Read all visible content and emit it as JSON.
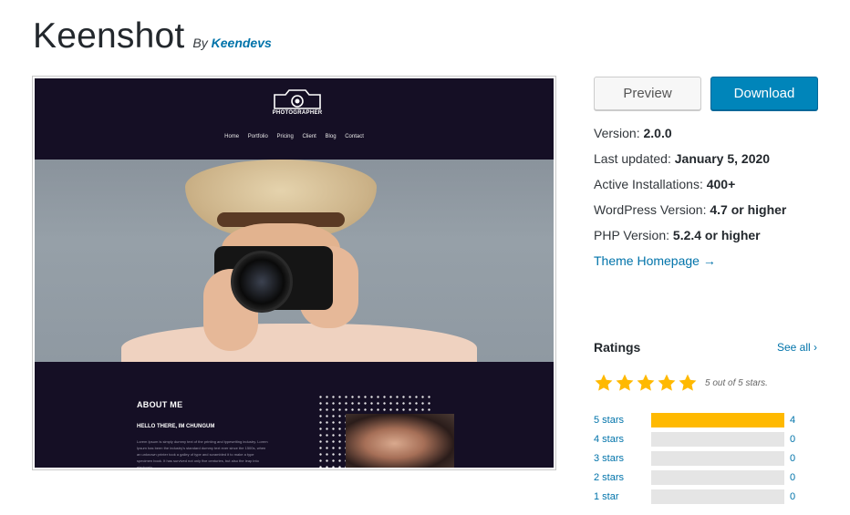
{
  "theme": {
    "title": "Keenshot",
    "by_label": "By",
    "author": "Keendevs"
  },
  "screenshot": {
    "logo_text": "PHOTOGRAPHER",
    "nav": [
      "Home",
      "Portfolio",
      "Pricing",
      "Client",
      "Blog",
      "Contact"
    ],
    "about_title": "ABOUT ME",
    "about_subtitle": "HELLO THERE, IM CHUNGUM",
    "about_text": "Lorem Ipsum is simply dummy text of the printing and typesetting industry. Lorem Ipsum has been the industry's standard dummy text ever since the 1500s, when an unknown printer took a galley of type and scrambled it to make a type specimen book. It has survived not only five centuries, but also the leap into electronic"
  },
  "actions": {
    "preview_label": "Preview",
    "download_label": "Download"
  },
  "meta": {
    "version_label": "Version:",
    "version_value": "2.0.0",
    "updated_label": "Last updated:",
    "updated_value": "January 5, 2020",
    "installs_label": "Active Installations:",
    "installs_value": "400+",
    "wp_label": "WordPress Version:",
    "wp_value": "4.7 or higher",
    "php_label": "PHP Version:",
    "php_value": "5.2.4 or higher",
    "homepage_label": "Theme Homepage →"
  },
  "ratings": {
    "title": "Ratings",
    "see_all": "See all",
    "see_all_icon": "chevron-right-icon",
    "stars_caption": "5 out of 5 stars.",
    "average": 5,
    "star_color": "#ffb900",
    "breakdown": [
      {
        "label": "5 stars",
        "count": "4",
        "fraction": 1.0
      },
      {
        "label": "4 stars",
        "count": "0",
        "fraction": 0
      },
      {
        "label": "3 stars",
        "count": "0",
        "fraction": 0
      },
      {
        "label": "2 stars",
        "count": "0",
        "fraction": 0
      },
      {
        "label": "1 star",
        "count": "0",
        "fraction": 0
      }
    ]
  },
  "colors": {
    "link": "#0073aa",
    "primary_button": "#0085ba"
  }
}
